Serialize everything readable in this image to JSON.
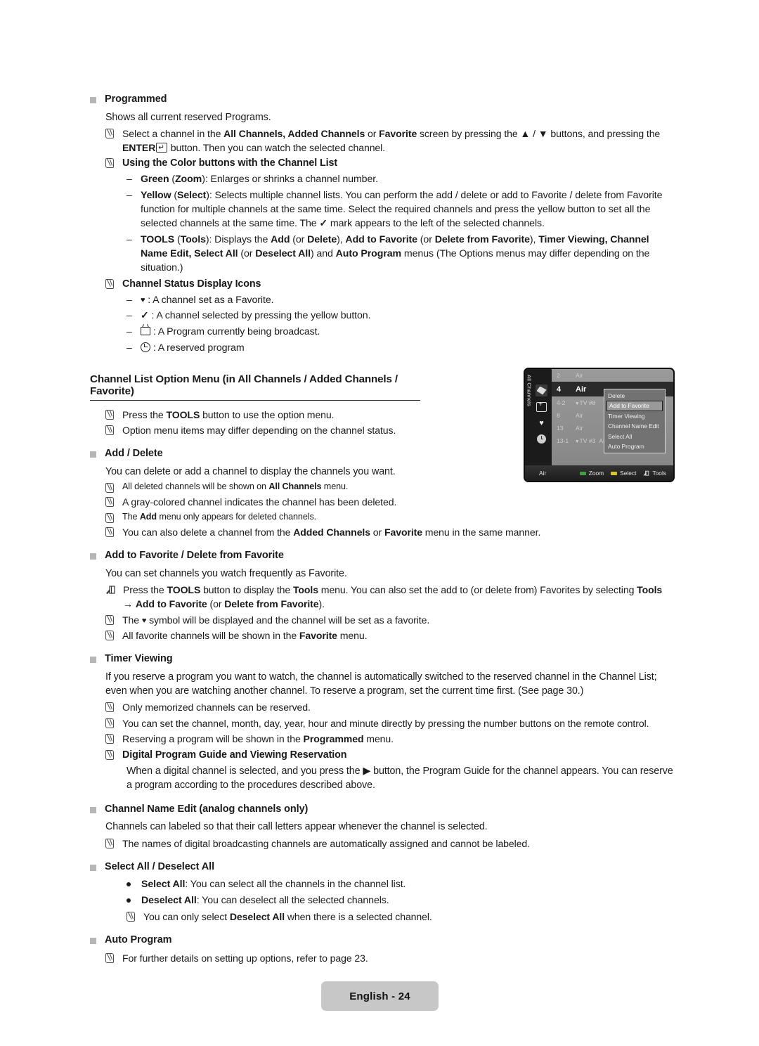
{
  "document": {
    "footer_label": "English - 24"
  },
  "sections": {
    "programmed": {
      "heading": "Programmed",
      "body": "Shows all current reserved Programs.",
      "note_select_channel_1": "Select a channel in the ",
      "note_select_channel_b1": "All Channels, Added Channels",
      "note_select_channel_2": " or ",
      "note_select_channel_b2": "Favorite",
      "note_select_channel_3": " screen by pressing the ▲ / ▼ buttons, and pressing the ",
      "note_select_channel_b3": "ENTER",
      "note_select_channel_key": "↵",
      "note_select_channel_4": " button. Then you can watch the selected channel.",
      "note_color_buttons": "Using the Color buttons with the Channel List",
      "dash_green_b": "Green",
      "dash_green_p1": " (",
      "dash_green_b2": "Zoom",
      "dash_green_p2": "): Enlarges or shrinks a channel number.",
      "dash_yellow_b": "Yellow",
      "dash_yellow_p1": " (",
      "dash_yellow_b2": "Select",
      "dash_yellow_p2": "): Selects multiple channel lists. You can perform the add / delete or add to Favorite / delete from Favorite function for multiple channels at the same time. Select the required channels and press the yellow button to set all the selected channels at the same time. The ",
      "dash_yellow_p3": " mark appears to the left of the selected channels.",
      "dash_tools_b": "TOOLS",
      "dash_tools_p1": " (",
      "dash_tools_b2": "Tools",
      "dash_tools_p2": "): Displays the ",
      "dash_tools_b3": "Add",
      "dash_tools_p3": " (or ",
      "dash_tools_b4": "Delete",
      "dash_tools_p4": "), ",
      "dash_tools_b5": "Add to Favorite",
      "dash_tools_p5": " (or ",
      "dash_tools_b6": "Delete from Favorite",
      "dash_tools_p6": "), ",
      "dash_tools_b7": "Timer Viewing, Channel Name Edit, Select All",
      "dash_tools_p7": " (or ",
      "dash_tools_b8": "Deselect All",
      "dash_tools_p8": ") and ",
      "dash_tools_b9": "Auto Program",
      "dash_tools_p9": " menus (The Options menus may differ depending on the situation.)",
      "note_status_icons": "Channel Status Display Icons",
      "status_heart": " : A channel set as a Favorite.",
      "status_check": " : A channel selected by pressing the yellow button.",
      "status_tv": " : A Program currently being broadcast.",
      "status_clock": " : A reserved program"
    },
    "option_menu": {
      "heading": "Channel List Option Menu (in All Channels / Added Channels / Favorite)",
      "note_press_1": "Press the ",
      "note_press_b": "TOOLS",
      "note_press_2": " button to use the option menu.",
      "note_items": "Option menu items may differ depending on the channel status."
    },
    "add_delete": {
      "heading": "Add / Delete",
      "body": "You can delete or add a channel to display the channels you want.",
      "note1_p1": "All deleted channels will be shown on ",
      "note1_b": "All Channels",
      "note1_p2": " menu.",
      "note2": "A gray-colored channel indicates the channel has been deleted.",
      "note3_p1": "The ",
      "note3_b": "Add",
      "note3_p2": " menu only appears for deleted channels.",
      "note4_p1": "You can also delete a channel from the ",
      "note4_b1": "Added Channels",
      "note4_p2": " or ",
      "note4_b2": "Favorite",
      "note4_p3": " menu in the same manner."
    },
    "add_favorite": {
      "heading": "Add to Favorite / Delete from Favorite",
      "body": "You can set channels you watch frequently as Favorite.",
      "tools_p1": "Press the ",
      "tools_b1": "TOOLS",
      "tools_p2": " button to display the ",
      "tools_b2": "Tools",
      "tools_p3": " menu. You can also set the add to (or delete from) Favorites by selecting ",
      "tools_b3": "Tools",
      "tools_p4": " → ",
      "tools_b4": "Add to Favorite",
      "tools_p5": " (or ",
      "tools_b5": "Delete from Favorite",
      "tools_p6": ").",
      "note1_p1": "The ",
      "note1_p2": " symbol will be displayed and the channel will be set as a favorite.",
      "note2_p1": "All favorite channels will be shown in the ",
      "note2_b": "Favorite",
      "note2_p2": " menu."
    },
    "timer_viewing": {
      "heading": "Timer Viewing",
      "body": "If you reserve a program you want to watch, the channel is automatically switched to the reserved channel in the Channel List; even when you are watching another channel. To reserve a program, set the current time first. (See page 30.)",
      "note1": "Only memorized channels can be reserved.",
      "note2": "You can set the channel, month, day, year, hour and minute directly by pressing the number buttons on the remote control.",
      "note3_p1": "Reserving a program will be shown in the ",
      "note3_b": "Programmed",
      "note3_p2": " menu.",
      "note4": "Digital Program Guide and Viewing Reservation",
      "sub_body_p1": "When a digital channel is selected, and you press the ▶ button, the Program Guide for the channel appears. You can reserve a program according to the procedures described above."
    },
    "channel_name_edit": {
      "heading": "Channel Name Edit (analog channels only)",
      "body": "Channels can labeled so that their call letters appear whenever the channel is selected.",
      "note1": "The names of digital broadcasting channels are automatically assigned and cannot be labeled."
    },
    "select_all": {
      "heading": "Select All / Deselect All",
      "bullet1_b": "Select All",
      "bullet1_p": ": You can select all the channels in the channel list.",
      "bullet2_b": "Deselect All",
      "bullet2_p": ": You can deselect all the selected channels.",
      "note1_p1": "You can only select ",
      "note1_b": "Deselect All",
      "note1_p2": " when there is a selected channel."
    },
    "auto_program": {
      "heading": "Auto Program",
      "note1": "For further details on setting up options, refer to page 23."
    }
  },
  "tv_screenshot": {
    "rail_label": "All Channels",
    "rail_icons": [
      "all-channels-icon",
      "added-channels-icon",
      "favorite-icon",
      "programmed-icon"
    ],
    "channels": [
      {
        "num": "2",
        "fav": "",
        "name": "Air",
        "extra": ""
      },
      {
        "num": "4",
        "fav": "",
        "name": "Air",
        "extra": ""
      },
      {
        "num": "4-2",
        "fav": "♥",
        "name": "TV #8",
        "extra": ""
      },
      {
        "num": "8",
        "fav": "",
        "name": "Air",
        "extra": ""
      },
      {
        "num": "13",
        "fav": "",
        "name": "Air",
        "extra": ""
      },
      {
        "num": "13-1",
        "fav": "♥",
        "name": "TV #3",
        "extra": "Air"
      }
    ],
    "selected_channel_index": 1,
    "menu_items": [
      "Delete",
      "Add to Favorite",
      "Timer Viewing",
      "Channel Name Edit",
      "Select All",
      "Auto Program"
    ],
    "menu_selected_index": 1,
    "bottom_bar": {
      "source": "Air",
      "green_label": "Zoom",
      "yellow_label": "Select",
      "tools_label": "Tools"
    }
  },
  "colors": {
    "section_square": "#b6b6b6",
    "footer_bg": "#c7c7c7",
    "green_button": "#3fa03f",
    "yellow_button": "#d9c52e",
    "tv_background": "#8e8e8e",
    "tv_selected_row": "#2a2a2a",
    "menu_bg": "#727272",
    "menu_highlight": "#9a9a9a"
  }
}
